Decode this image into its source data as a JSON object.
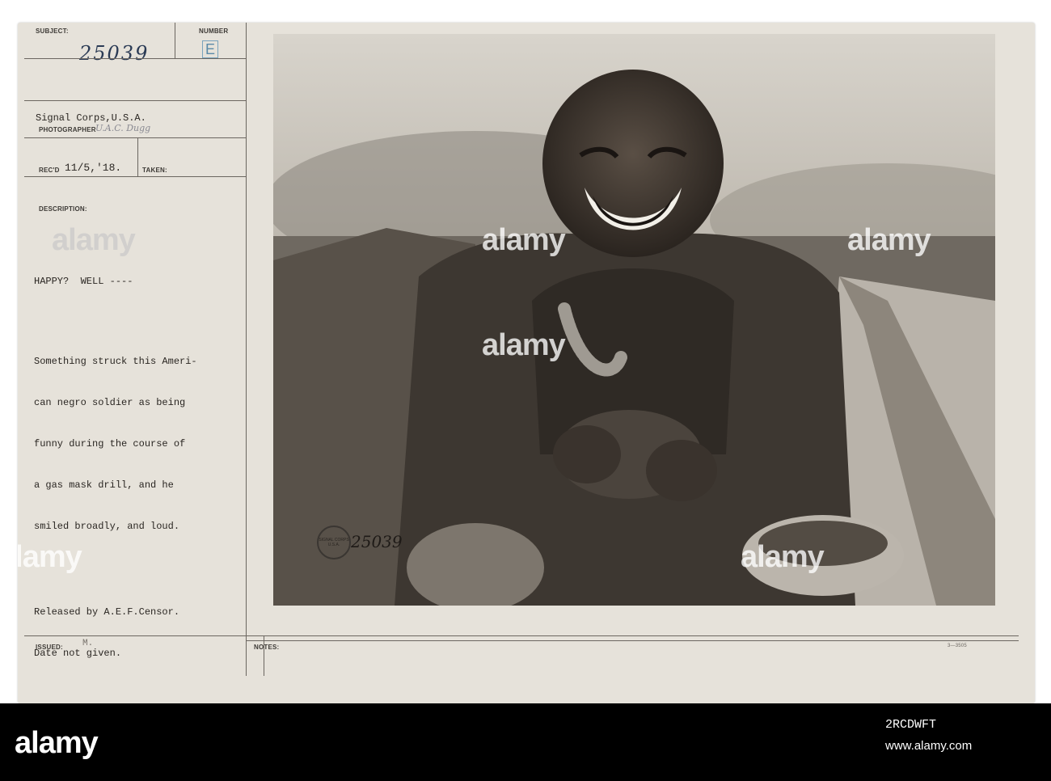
{
  "card": {
    "subject_label": "SUBJECT:",
    "subject_number": "25039",
    "number_label": "NUMBER",
    "number_value": "E",
    "photographer_line": "Signal Corps,U.S.A.",
    "photographer_label": "PHOTOGRAPHER",
    "photographer_signature": "U.A.C. Dugg",
    "recd_label": "REC'D",
    "recd_value": "11/5,'18.",
    "taken_label": "TAKEN:",
    "description_label": "DESCRIPTION:",
    "headline": "HAPPY?  WELL ----",
    "description_lines": [
      "Something struck this Ameri-",
      "can negro soldier as being",
      "funny during the course of",
      "a gas mask drill, and he",
      "smiled broadly, and loud."
    ],
    "release_lines": [
      "Released by A.E.F.Censor.",
      "Date not given."
    ],
    "issued_label": "ISSUED:",
    "issued_value": "M.",
    "notes_label": "NOTES:",
    "form_code": "3—3505"
  },
  "photo": {
    "stamp_text": "SIGNAL CORPS U.S.A.",
    "photo_number": "25039"
  },
  "watermark": {
    "text": "alamy"
  },
  "footer": {
    "logo": "alamy",
    "image_id": "2RCDWFT",
    "url": "www.alamy.com"
  }
}
